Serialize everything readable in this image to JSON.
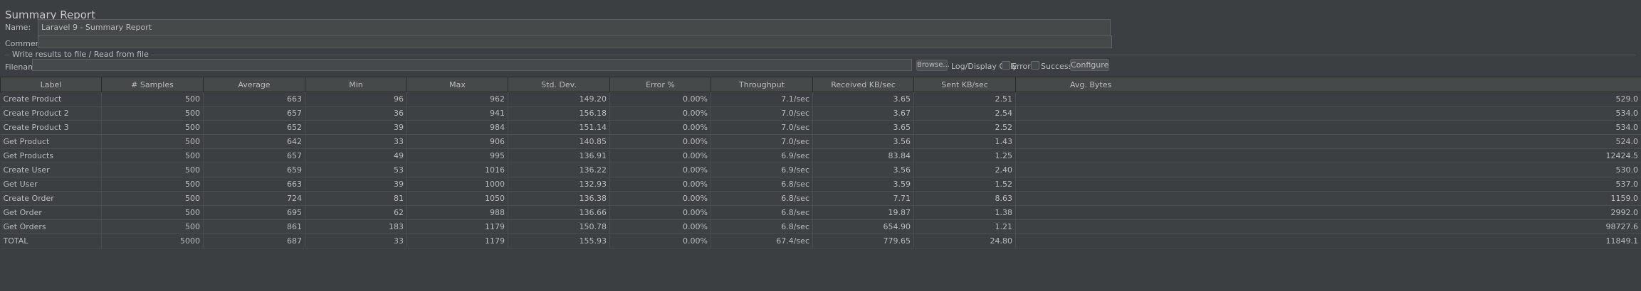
{
  "panel": {
    "title": "Summary Report"
  },
  "name": {
    "label": "Name:",
    "value": "Laravel 9 - Summary Report"
  },
  "comments": {
    "label": "Comments:",
    "value": ""
  },
  "file_group": {
    "title": "Write results to file / Read from file",
    "filename_label": "Filename",
    "filename_value": "",
    "browse_label": "Browse...",
    "log_display_label": "Log/Display Only:",
    "errors_label": "Errors",
    "successes_label": "Successes",
    "configure_label": "Configure"
  },
  "table": {
    "columns": [
      "Label",
      "# Samples",
      "Average",
      "Min",
      "Max",
      "Std. Dev.",
      "Error %",
      "Throughput",
      "Received KB/sec",
      "Sent KB/sec",
      "Avg. Bytes"
    ],
    "rows": [
      [
        "Create Product",
        "500",
        "663",
        "96",
        "962",
        "149.20",
        "0.00%",
        "7.1/sec",
        "3.65",
        "2.51",
        "529.0"
      ],
      [
        "Create Product 2",
        "500",
        "657",
        "36",
        "941",
        "156.18",
        "0.00%",
        "7.0/sec",
        "3.67",
        "2.54",
        "534.0"
      ],
      [
        "Create Product 3",
        "500",
        "652",
        "39",
        "984",
        "151.14",
        "0.00%",
        "7.0/sec",
        "3.65",
        "2.52",
        "534.0"
      ],
      [
        "Get Product",
        "500",
        "642",
        "33",
        "906",
        "140.85",
        "0.00%",
        "7.0/sec",
        "3.56",
        "1.43",
        "524.0"
      ],
      [
        "Get Products",
        "500",
        "657",
        "49",
        "995",
        "136.91",
        "0.00%",
        "6.9/sec",
        "83.84",
        "1.25",
        "12424.5"
      ],
      [
        "Create User",
        "500",
        "659",
        "53",
        "1016",
        "136.22",
        "0.00%",
        "6.9/sec",
        "3.56",
        "2.40",
        "530.0"
      ],
      [
        "Get User",
        "500",
        "663",
        "39",
        "1000",
        "132.93",
        "0.00%",
        "6.8/sec",
        "3.59",
        "1.52",
        "537.0"
      ],
      [
        "Create Order",
        "500",
        "724",
        "81",
        "1050",
        "136.38",
        "0.00%",
        "6.8/sec",
        "7.71",
        "8.63",
        "1159.0"
      ],
      [
        "Get Order",
        "500",
        "695",
        "62",
        "988",
        "136.66",
        "0.00%",
        "6.8/sec",
        "19.87",
        "1.38",
        "2992.0"
      ],
      [
        "Get Orders",
        "500",
        "861",
        "183",
        "1179",
        "150.78",
        "0.00%",
        "6.8/sec",
        "654.90",
        "1.21",
        "98727.6"
      ],
      [
        "TOTAL",
        "5000",
        "687",
        "33",
        "1179",
        "155.93",
        "0.00%",
        "67.4/sec",
        "779.65",
        "24.80",
        "11849.1"
      ]
    ]
  }
}
